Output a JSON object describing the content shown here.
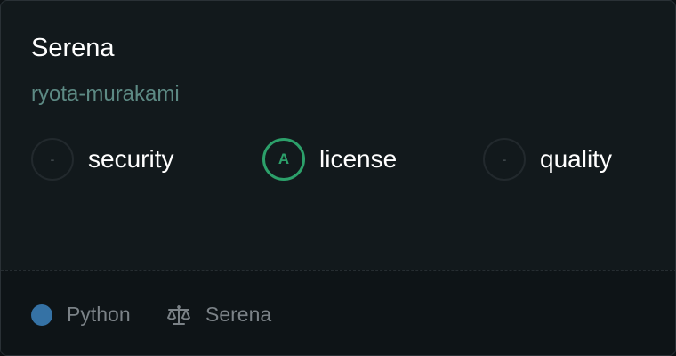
{
  "repo": {
    "name": "Serena",
    "owner": "ryota-murakami"
  },
  "scores": [
    {
      "label": "security",
      "grade": "-",
      "status": "none"
    },
    {
      "label": "license",
      "grade": "A",
      "status": "good"
    },
    {
      "label": "quality",
      "grade": "-",
      "status": "none"
    }
  ],
  "footer": {
    "language": "Python",
    "language_color": "#3572a5",
    "license_icon": "scale-icon",
    "license": "Serena"
  },
  "colors": {
    "grade_good": "#2ca06a",
    "owner_text": "#5d8a84"
  }
}
